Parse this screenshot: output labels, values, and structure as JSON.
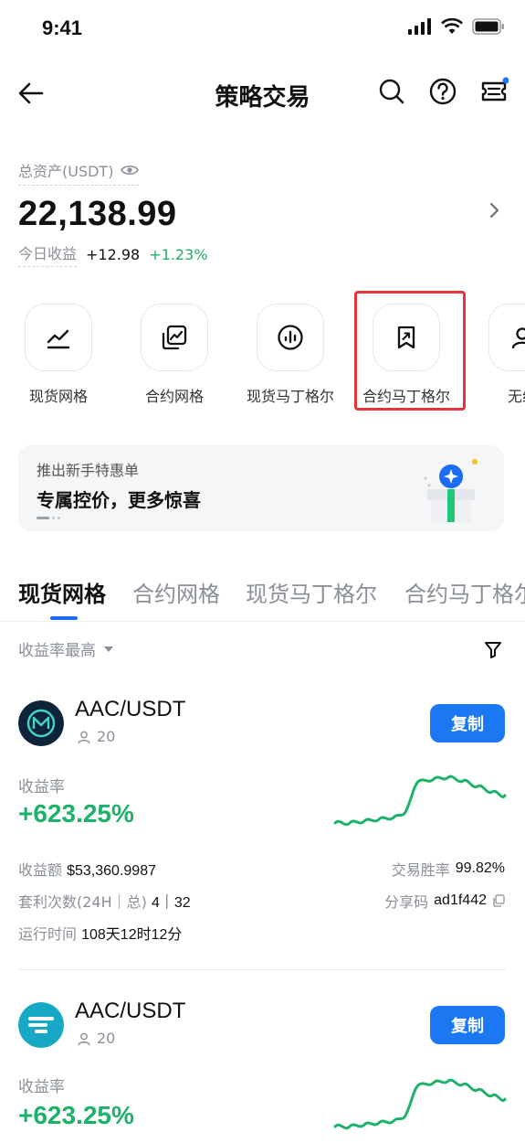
{
  "status": {
    "time": "9:41"
  },
  "nav": {
    "title": "策略交易"
  },
  "assets": {
    "label": "总资产(USDT)",
    "value": "22,138.99",
    "today_label": "今日收益",
    "today_amount": "+12.98",
    "today_percent": "+1.23%"
  },
  "quick": [
    {
      "label": "现货网格",
      "icon": "grid-chart-icon"
    },
    {
      "label": "合约网格",
      "icon": "contract-chart-icon"
    },
    {
      "label": "现货马丁格尔",
      "icon": "bars-circle-icon"
    },
    {
      "label": "合约马丁格尔",
      "icon": "bookmark-arrow-icon"
    },
    {
      "label": "无线",
      "icon": "user-icon"
    }
  ],
  "promo": {
    "subtitle": "推出新手特惠单",
    "title": "专属控价，更多惊喜"
  },
  "tabs": [
    "现货网格",
    "合约网格",
    "现货马丁格尔",
    "合约马丁格尔"
  ],
  "sort": {
    "label": "收益率最高"
  },
  "cards": [
    {
      "pair": "AAC/USDT",
      "users": "20",
      "copy_label": "复制",
      "roi_label": "收益率",
      "roi_value": "+623.25%",
      "profit_label": "收益额",
      "profit_value": "$53,360.9987",
      "winrate_label": "交易胜率",
      "winrate_value": "99.82%",
      "arb_label": "套利次数(24H｜总)",
      "arb_value": "4｜32",
      "share_label": "分享码",
      "share_value": "ad1f442",
      "runtime_label": "运行时间",
      "runtime_value": "108天12时12分"
    },
    {
      "pair": "AAC/USDT",
      "users": "20",
      "copy_label": "复制",
      "roi_label": "收益率",
      "roi_value": "+623.25%"
    }
  ],
  "colors": {
    "accent": "#1b78f2",
    "positive": "#1db16a",
    "highlight": "#e8333a"
  }
}
